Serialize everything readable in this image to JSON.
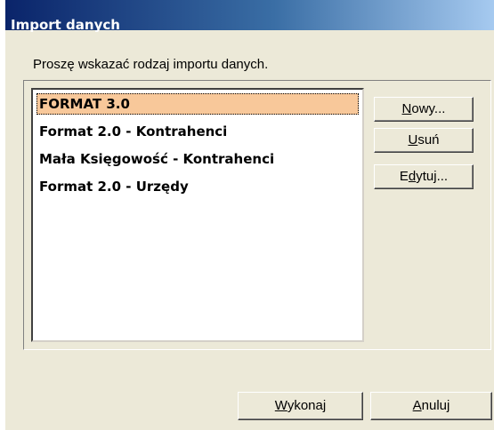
{
  "window": {
    "title": "Import danych"
  },
  "prompt": "Proszę wskazać rodzaj importu danych.",
  "list": {
    "items": [
      {
        "label": "FORMAT 3.0",
        "selected": true
      },
      {
        "label": "Format 2.0 - Kontrahenci",
        "selected": false
      },
      {
        "label": "Mała Księgowość - Kontrahenci",
        "selected": false
      },
      {
        "label": "Format 2.0 - Urzędy",
        "selected": false
      }
    ],
    "selected_color": "#f8c89a"
  },
  "buttons": {
    "new": {
      "mnemonic": "N",
      "rest": "owy..."
    },
    "delete": {
      "mnemonic": "U",
      "rest": "suń"
    },
    "edit": {
      "before": "E",
      "mnemonic": "d",
      "rest": "ytuj..."
    },
    "execute": {
      "mnemonic": "W",
      "rest": "ykonaj"
    },
    "cancel": {
      "mnemonic": "A",
      "rest": "nuluj"
    }
  }
}
